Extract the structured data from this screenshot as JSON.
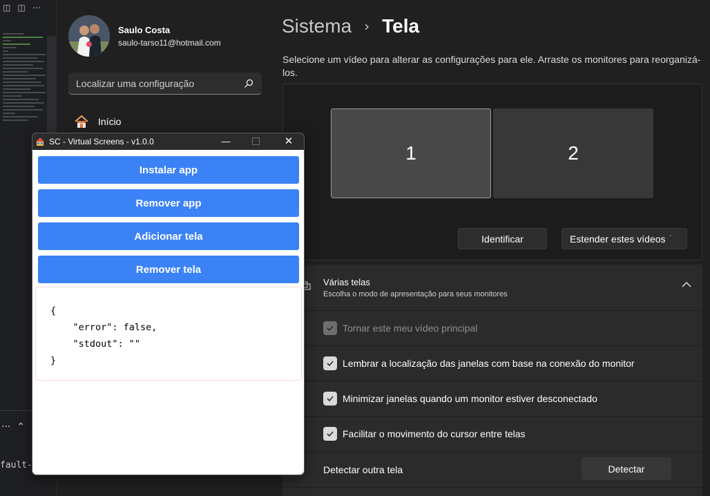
{
  "editor": {
    "top_icons": [
      "split-editor-icon",
      "layout-icon",
      "more-icon"
    ],
    "panel_more": "···",
    "code_fragment": "fault-ex"
  },
  "user": {
    "name": "Saulo Costa",
    "email": "saulo-tarso11@hotmail.com"
  },
  "search": {
    "placeholder": "Localizar uma configuração"
  },
  "nav": {
    "home_label": "Início"
  },
  "breadcrumb": {
    "parent": "Sistema",
    "current": "Tela"
  },
  "description": "Selecione um vídeo para alterar as configurações para ele. Arraste os monitores para reorganizá-los.",
  "monitors": {
    "monitor1_label": "1",
    "monitor2_label": "2",
    "identify_label": "Identificar",
    "extend_label": "Estender estes vídeos"
  },
  "multiple_displays": {
    "title": "Várias telas",
    "subtitle": "Escolha o modo de apresentação para seus monitores",
    "options": [
      {
        "label": "Tornar este meu vídeo principal",
        "checked": true,
        "disabled": true
      },
      {
        "label": "Lembrar a localização das janelas com base na conexão do monitor",
        "checked": true,
        "disabled": false
      },
      {
        "label": "Minimizar janelas quando um monitor estiver desconectado",
        "checked": true,
        "disabled": false
      },
      {
        "label": "Facilitar o movimento do cursor entre telas",
        "checked": true,
        "disabled": false
      }
    ],
    "detect_label": "Detectar outra tela",
    "detect_button": "Detectar"
  },
  "vs_window": {
    "title": "SC - Virtual Screens - v1.0.0",
    "buttons": {
      "install": "Instalar app",
      "remove_app": "Remover app",
      "add_screen": "Adicionar tela",
      "remove_screen": "Remover tela"
    },
    "output": "{\n    \"error\": false,\n    \"stdout\": \"\"\n}",
    "button_color": "#3b82f6"
  },
  "colors": {
    "background": "#202020",
    "panel": "#2b2b2b",
    "accent_button": "#3b82f6"
  }
}
